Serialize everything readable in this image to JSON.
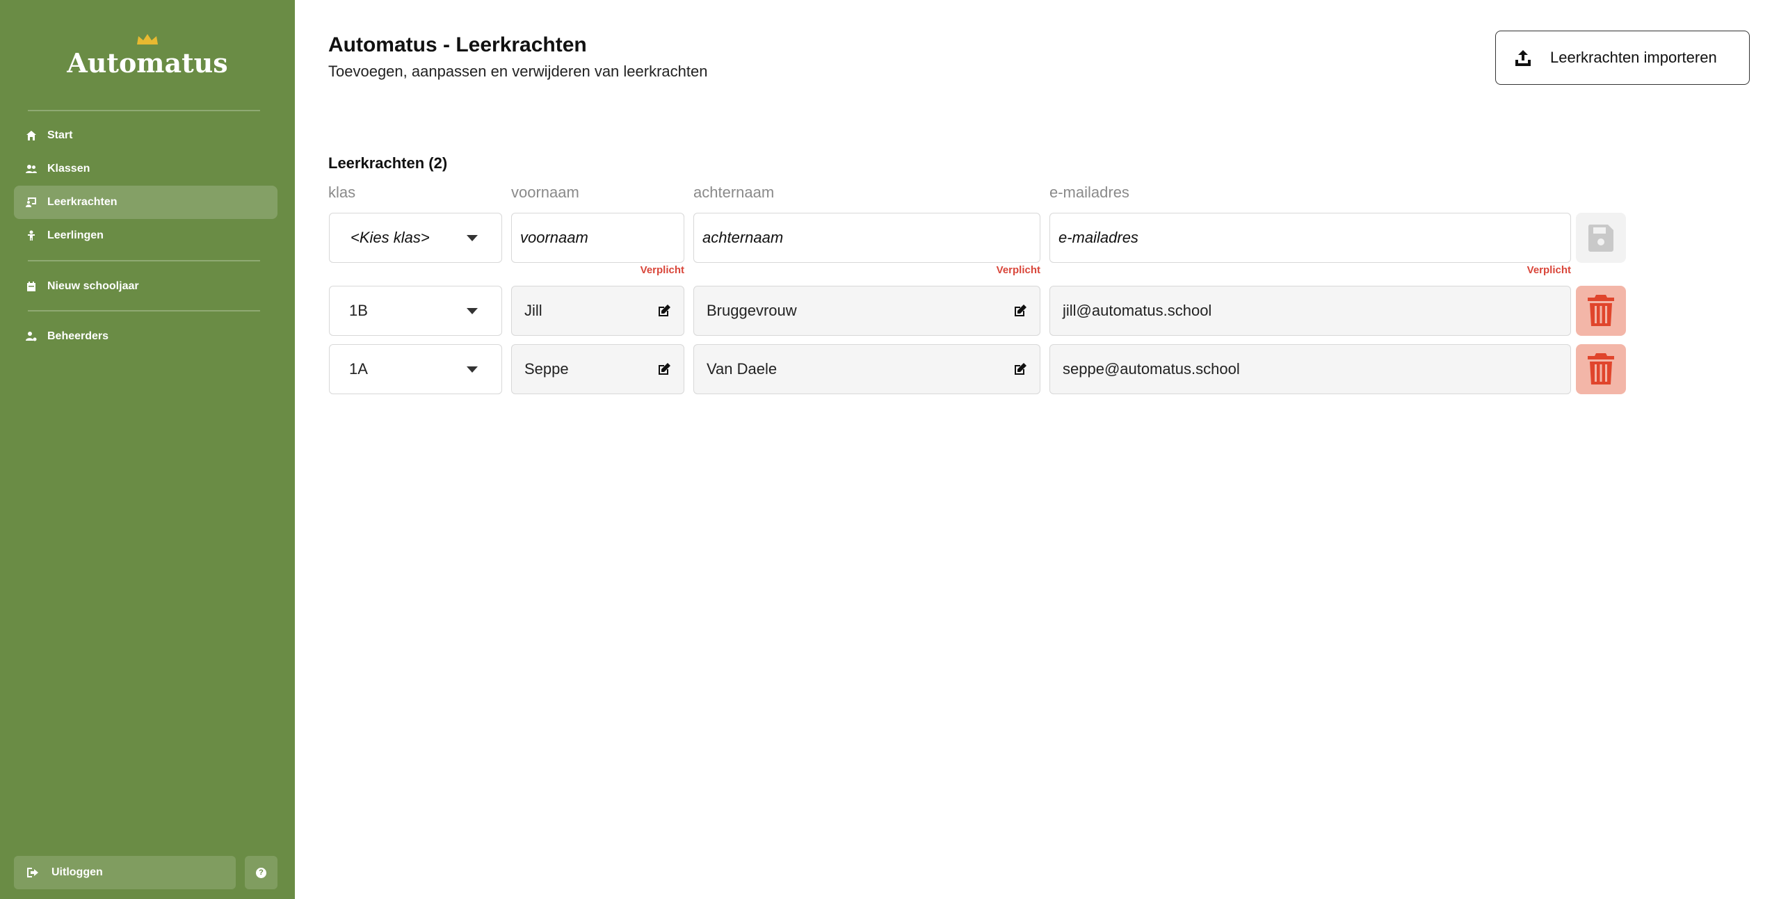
{
  "sidebar": {
    "logo_text": "Automatus",
    "items": [
      {
        "label": "Start",
        "icon": "home-icon"
      },
      {
        "label": "Klassen",
        "icon": "users-icon"
      },
      {
        "label": "Leerkrachten",
        "icon": "chalkboard-teacher-icon"
      },
      {
        "label": "Leerlingen",
        "icon": "child-icon"
      },
      {
        "label": "Nieuw schooljaar",
        "icon": "calendar-icon"
      },
      {
        "label": "Beheerders",
        "icon": "user-gear-icon"
      }
    ],
    "logout_label": "Uitloggen",
    "help_label": "?"
  },
  "header": {
    "title": "Automatus - Leerkrachten",
    "subtitle": "Toevoegen, aanpassen en verwijderen van leerkrachten",
    "import_label": "Leerkrachten importeren"
  },
  "teachers": {
    "section_title": "Leerkrachten (2)",
    "columns": [
      "klas",
      "voornaam",
      "achternaam",
      "e-mailadres"
    ],
    "new_row": {
      "klas_placeholder": "<Kies klas>",
      "voornaam_placeholder": "voornaam",
      "achternaam_placeholder": "achternaam",
      "email_placeholder": "e-mailadres",
      "required_label": "Verplicht"
    },
    "rows": [
      {
        "klas": "1B",
        "voornaam": "Jill",
        "achternaam": "Bruggevrouw",
        "email": "jill@automatus.school"
      },
      {
        "klas": "1A",
        "voornaam": "Seppe",
        "achternaam": "Van Daele",
        "email": "seppe@automatus.school"
      }
    ]
  },
  "colors": {
    "sidebar": "#6a8c45",
    "accent_gold": "#e8b931",
    "required": "#d9463a",
    "delete_bg": "#f3b6a8",
    "delete_icon": "#e0452c"
  }
}
